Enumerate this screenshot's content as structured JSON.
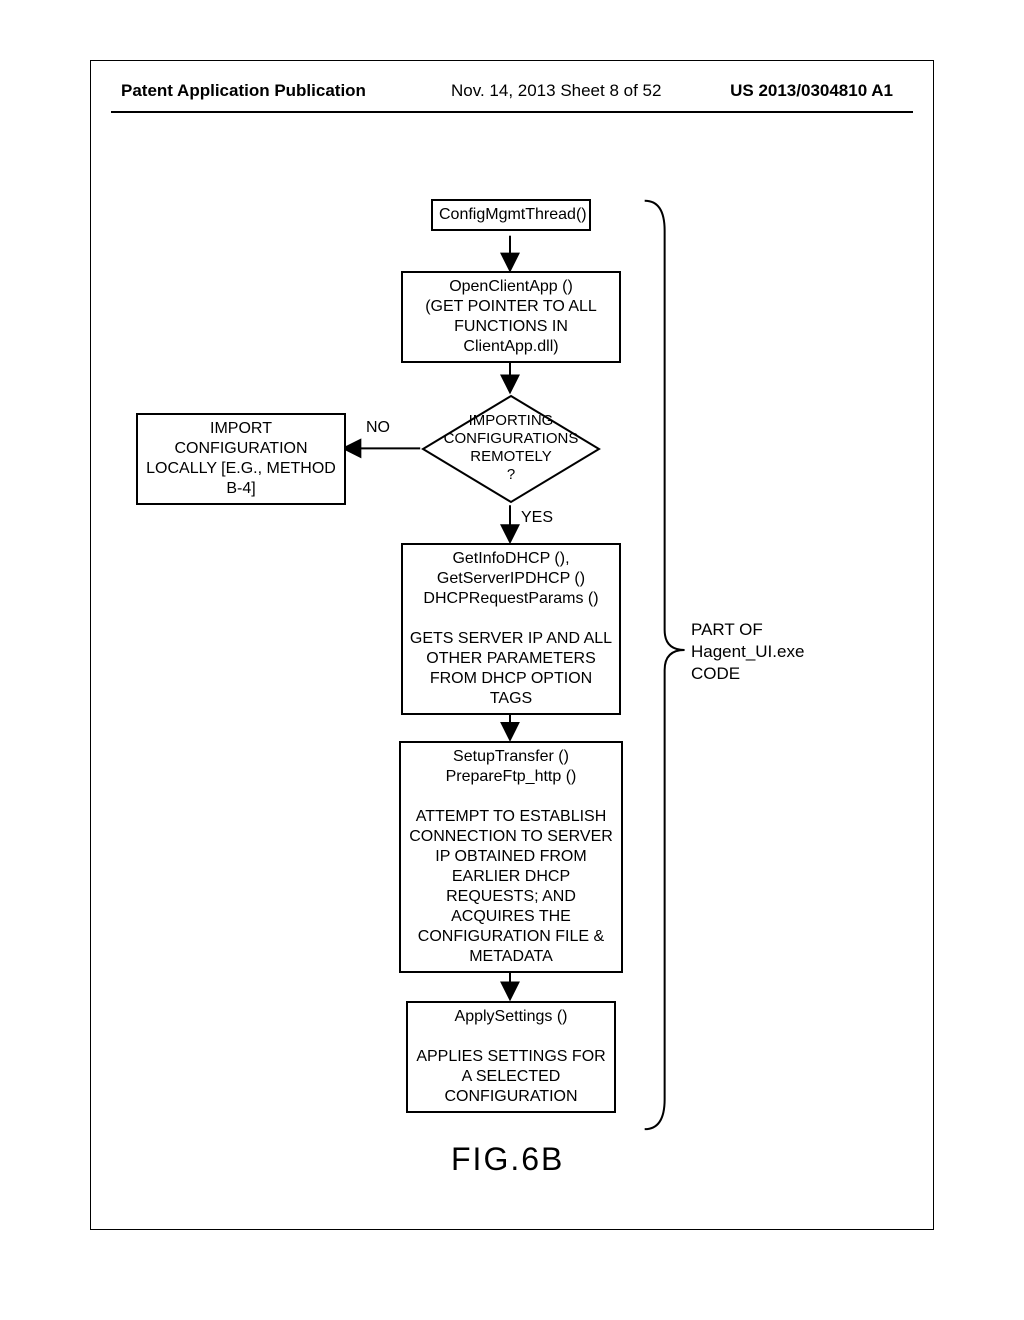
{
  "header": {
    "left": "Patent Application Publication",
    "mid": "Nov. 14, 2013  Sheet 8 of 52",
    "right": "US 2013/0304810 A1"
  },
  "flow": {
    "start": "ConfigMgmtThread()",
    "open_client": "OpenClientApp ()\n(GET POINTER TO ALL FUNCTIONS IN ClientApp.dll)",
    "decision": "IMPORTING\nCONFIGURATIONS\nREMOTELY\n?",
    "no_label": "NO",
    "yes_label": "YES",
    "no_branch": "IMPORT CONFIGURATION LOCALLY [E.G., METHOD B-4]",
    "dhcp": "GetInfoDHCP (),\nGetServerIPDHCP ()\nDHCPRequestParams ()\n\nGETS SERVER IP AND ALL OTHER PARAMETERS FROM DHCP OPTION TAGS",
    "setup": "SetupTransfer ()\nPrepareFtp_http ()\n\nATTEMPT TO ESTABLISH CONNECTION TO SERVER IP OBTAINED FROM EARLIER DHCP REQUESTS; AND ACQUIRES THE CONFIGURATION FILE & METADATA",
    "apply": "ApplySettings ()\n\nAPPLIES SETTINGS FOR A SELECTED CONFIGURATION"
  },
  "side_note": "PART OF\nHagent_UI.exe\nCODE",
  "figure_label": "FIG.6B"
}
